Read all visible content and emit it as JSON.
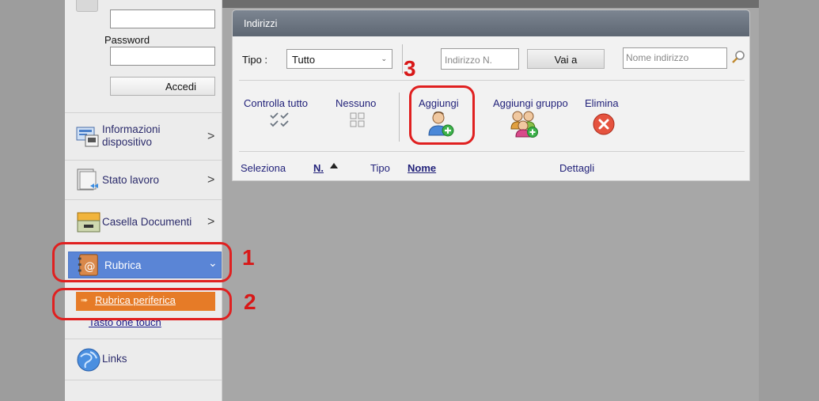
{
  "login": {
    "password_label": "Password",
    "login_button": "Accedi"
  },
  "sidebar": {
    "items": [
      {
        "label": "Informazioni\ndispositivo",
        "icon": "device-info-icon"
      },
      {
        "label": "Stato lavoro",
        "icon": "job-status-icon"
      },
      {
        "label": "Casella Documenti",
        "icon": "document-box-icon"
      },
      {
        "label": "Rubrica",
        "icon": "address-book-icon"
      },
      {
        "label": "Links",
        "icon": "globe-icon"
      }
    ],
    "sub_items": [
      {
        "label": "Rubrica periferica"
      },
      {
        "label": "Tasto one touch"
      }
    ]
  },
  "panel": {
    "title": "Indirizzi",
    "tipo_label": "Tipo :",
    "tipo_value": "Tutto",
    "address_placeholder": "Indirizzo N.",
    "goto_button": "Vai a",
    "name_placeholder": "Nome indirizzo",
    "actions": {
      "check_all": "Controlla tutto",
      "none": "Nessuno",
      "add": "Aggiungi",
      "add_group": "Aggiungi gruppo",
      "delete": "Elimina"
    },
    "columns": {
      "select": "Seleziona",
      "number": "N.",
      "type": "Tipo",
      "name": "Nome",
      "details": "Dettagli"
    }
  },
  "annotations": [
    "1",
    "2",
    "3"
  ],
  "colors": {
    "accent_blue": "#5a85d6",
    "accent_orange": "#e67b27",
    "callout_red": "#e02020",
    "delete_red": "#e5533f"
  }
}
